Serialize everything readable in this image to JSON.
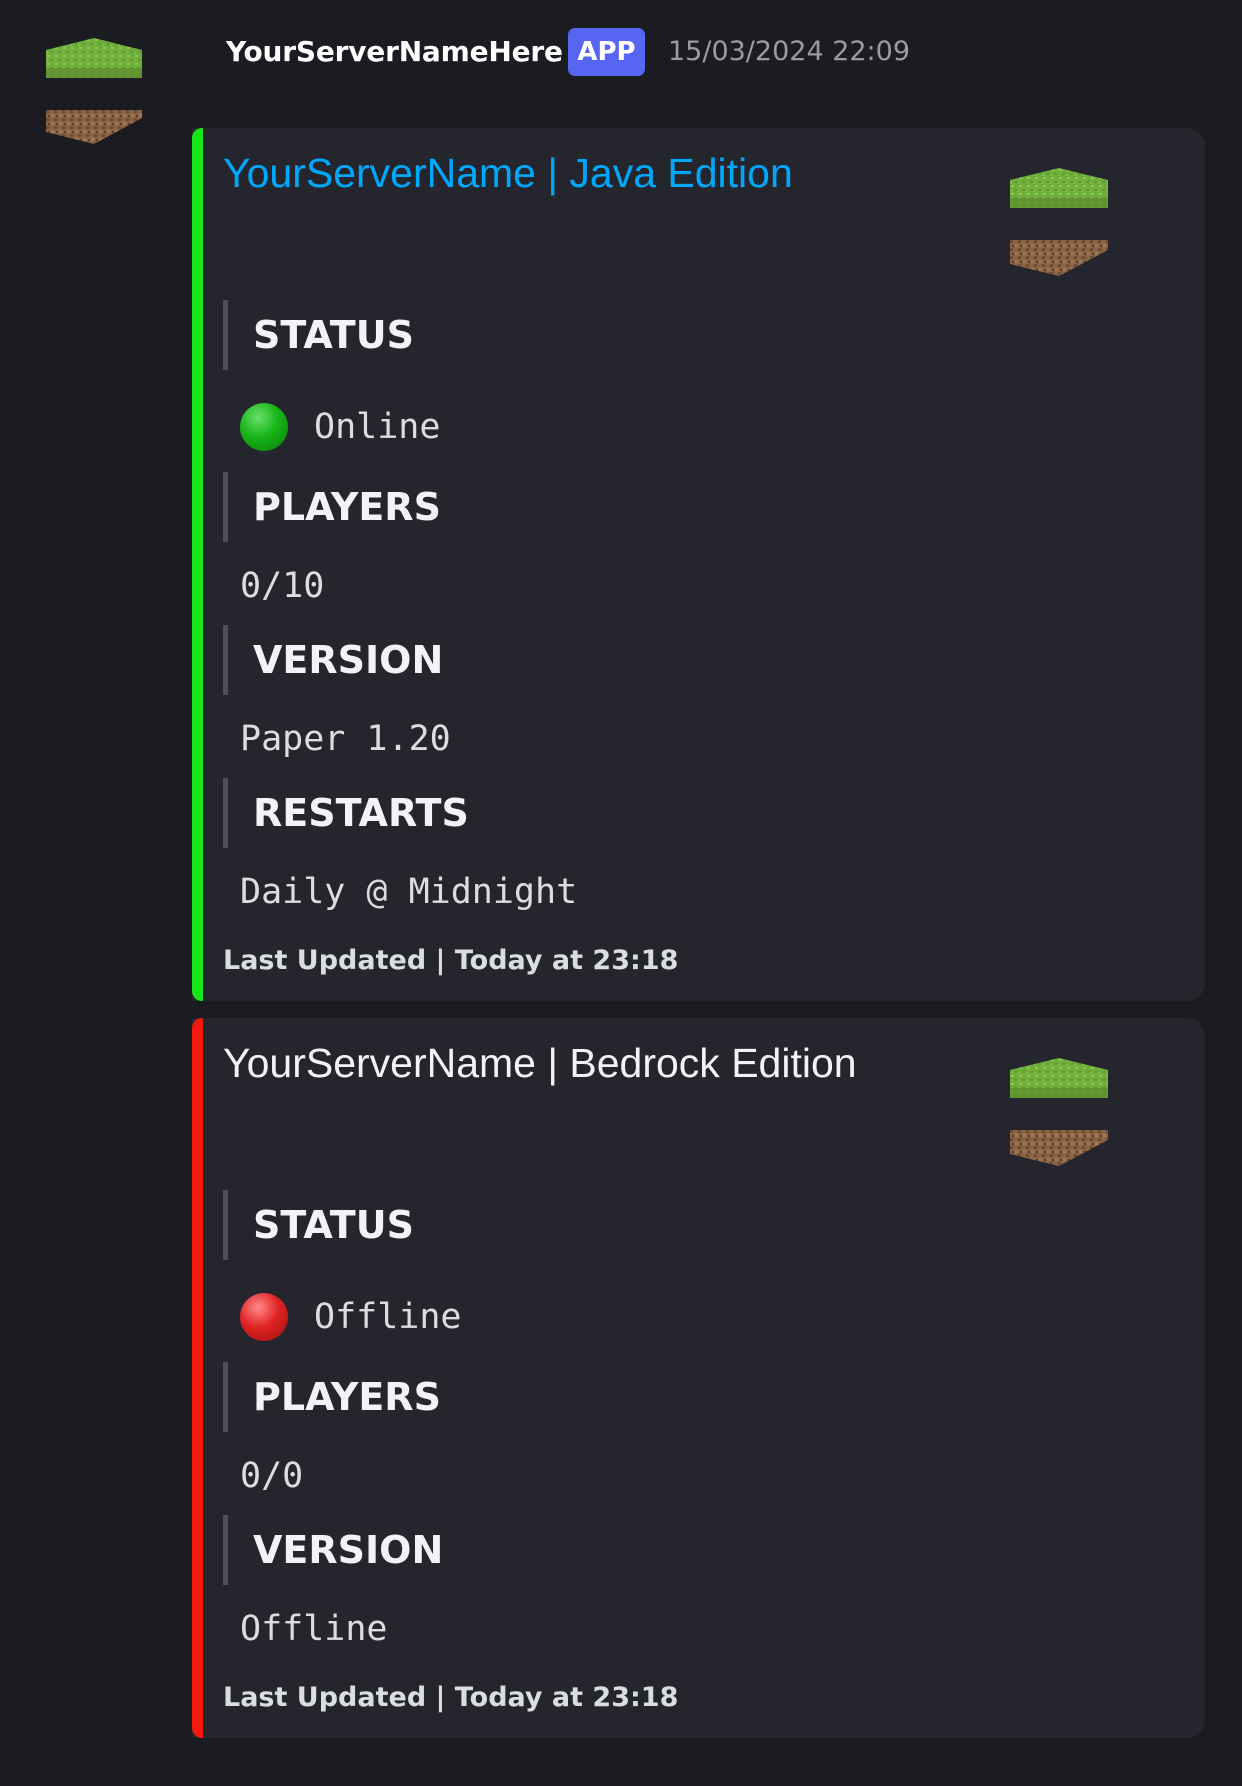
{
  "message": {
    "author": "YourServerNameHere",
    "badge": "APP",
    "timestamp": "15/03/2024 22:09",
    "avatar_icon": "grass-block-icon"
  },
  "embeds": [
    {
      "title": "YourServerName | Java Edition",
      "title_color": "#00a8fc",
      "accent_color": "#17e617",
      "thumbnail_icon": "grass-block-icon",
      "status_label": "STATUS",
      "status_value": "Online",
      "status_dot_color": "#1fb81f",
      "players_label": "PLAYERS",
      "players_value": "0/10",
      "version_label": "VERSION",
      "version_value": "Paper 1.20",
      "restarts_label": "RESTARTS",
      "restarts_value": "Daily @ Midnight",
      "footer": "Last Updated | Today at 23:18"
    },
    {
      "title": "YourServerName | Bedrock Edition",
      "title_color": "#f2f3f5",
      "accent_color": "#f21a0f",
      "thumbnail_icon": "grass-block-icon",
      "status_label": "STATUS",
      "status_value": "Offline",
      "status_dot_color": "#e02323",
      "players_label": "PLAYERS",
      "players_value": "0/0",
      "version_label": "VERSION",
      "version_value": "Offline",
      "footer": "Last Updated | Today at 23:18"
    }
  ]
}
